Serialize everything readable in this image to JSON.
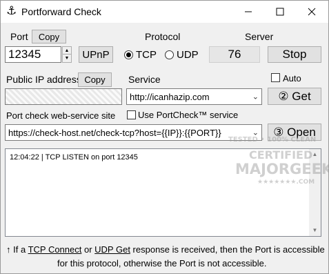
{
  "window": {
    "title": "Portforward Check"
  },
  "port": {
    "label": "Port",
    "copy_label": "Copy",
    "value": "12345",
    "upnp_label": "UPnP"
  },
  "protocol": {
    "label": "Protocol",
    "tcp_label": "TCP",
    "udp_label": "UDP",
    "selected": "TCP"
  },
  "server": {
    "label": "Server",
    "count": "76",
    "stop_label": "Stop"
  },
  "public_ip": {
    "label": "Public IP address",
    "copy_label": "Copy",
    "value": ""
  },
  "service": {
    "label": "Service",
    "value": "http://icanhazip.com",
    "auto_label": "Auto",
    "get_label": "② Get"
  },
  "check_site": {
    "label": "Port check web-service site",
    "use_portcheck_label": "Use PortCheck™ service",
    "value": "https://check-host.net/check-tcp?host={{IP}}:{{PORT}}",
    "open_label": "③ Open"
  },
  "log": {
    "lines": [
      "12:04:22 | TCP LISTEN on port 12345"
    ]
  },
  "footer": {
    "part1": "↑ If a ",
    "tcp_connect": "TCP Connect",
    "part2": " or ",
    "udp_get": "UDP Get",
    "part3": " response is received, then the Port is accessible",
    "line2": "for this protocol, otherwise the Port is not accessible."
  },
  "watermark": {
    "line1": "TESTED • 100% CLEAN",
    "line2": "CERTIFIED",
    "line3": "MAJORGEEKS",
    "line4": "★★★★★★★.COM"
  }
}
